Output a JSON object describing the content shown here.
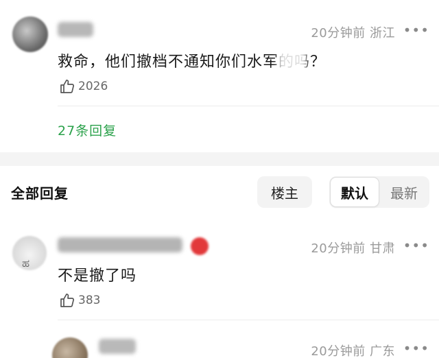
{
  "main_comment": {
    "time": "20分钟前",
    "location": "浙江",
    "text": "救命，他们撤档不通知你们水军的吗？",
    "likes": "2026",
    "replies_label": "27条回复",
    "more": "•••"
  },
  "replies_section": {
    "title": "全部回复",
    "owner_label": "楼主",
    "sort_default_label": "默认",
    "sort_newest_label": "最新"
  },
  "replies": [
    {
      "time": "20分钟前",
      "location": "甘肃",
      "text": "不是撤了吗",
      "likes": "383",
      "more": "•••"
    },
    {
      "time": "20分钟前",
      "location": "广东",
      "more": "•••"
    }
  ]
}
